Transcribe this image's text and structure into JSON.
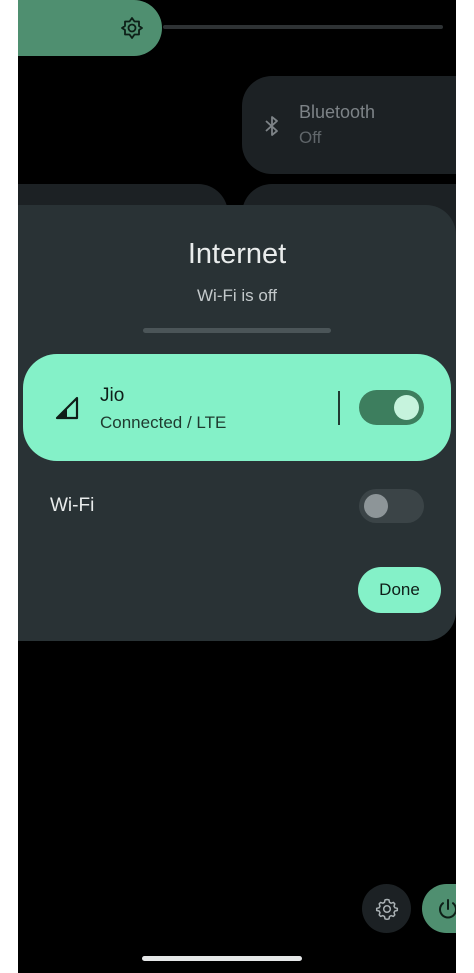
{
  "quick_settings": {
    "bluetooth_tile": {
      "title": "Bluetooth",
      "state": "Off"
    }
  },
  "internet_dialog": {
    "title": "Internet",
    "subtitle": "Wi-Fi is off",
    "carrier": {
      "name": "Jio",
      "status": "Connected / LTE",
      "toggle_on": true
    },
    "wifi": {
      "label": "Wi-Fi",
      "toggle_on": false
    },
    "done_label": "Done"
  },
  "icons": [
    "brightness-icon",
    "bluetooth-icon",
    "signal-icon",
    "settings-icon",
    "power-icon"
  ],
  "colors": {
    "accent": "#84f1c8",
    "accent_dark": "#4f8f70",
    "dialog_bg": "#293235",
    "tile_bg": "#1c2124"
  }
}
